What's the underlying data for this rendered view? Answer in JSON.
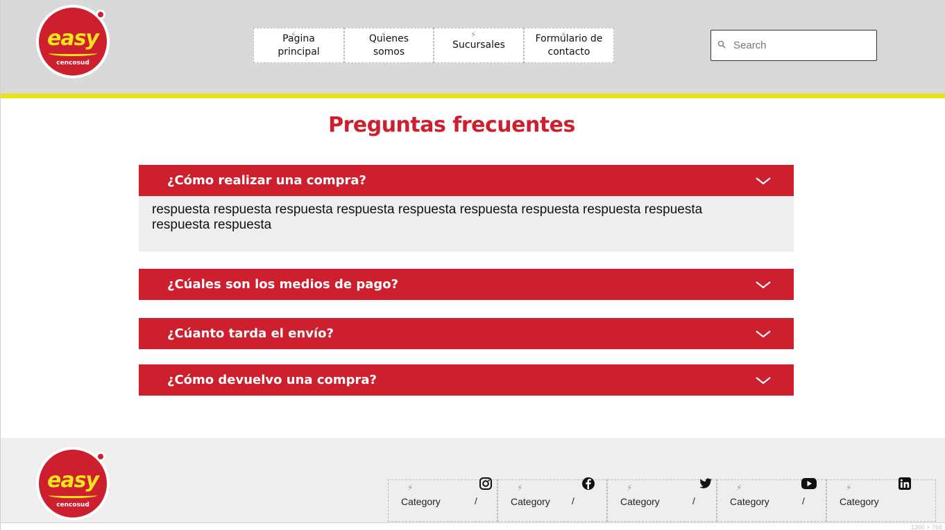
{
  "header": {
    "logo": {
      "brand": "easy",
      "sub": "cencosud"
    },
    "nav": [
      {
        "label": "Pagina principal",
        "lines": [
          "Pagina",
          "principal"
        ]
      },
      {
        "label": "Quienes somos",
        "lines": [
          "Quienes",
          "somos"
        ]
      },
      {
        "label": "Sucursales",
        "lines": [
          "Sucursales"
        ]
      },
      {
        "label": "Formulario de contacto",
        "lines": [
          "Formulario de",
          "contacto"
        ]
      }
    ],
    "search": {
      "placeholder": "Search",
      "value": ""
    }
  },
  "main": {
    "title": "Preguntas frecuentes",
    "faqs": [
      {
        "question": "¿Cómo realizar una compra?",
        "expanded": true,
        "answer": "respuesta respuesta respuesta respuesta respuesta respuesta respuesta respuesta respuesta respuesta respuesta"
      },
      {
        "question": "¿Cúales son los medios de pago?",
        "expanded": false
      },
      {
        "question": "¿Cúanto tarda el envío?",
        "expanded": false
      },
      {
        "question": "¿Cómo devuelvo una compra?",
        "expanded": false
      }
    ]
  },
  "footer": {
    "logo": {
      "brand": "easy",
      "sub": "cencosud"
    },
    "categories": [
      {
        "label": "Category",
        "separator": "/",
        "icon": "instagram-icon"
      },
      {
        "label": "Category",
        "separator": "/",
        "icon": "facebook-icon"
      },
      {
        "label": "Category",
        "separator": "/",
        "icon": "twitter-icon"
      },
      {
        "label": "Category",
        "separator": "/",
        "icon": "youtube-icon"
      },
      {
        "label": "Category",
        "separator": "",
        "icon": "linkedin-icon"
      }
    ],
    "resize_label": "1366 × 768"
  },
  "colors": {
    "brand_red": "#cd1f2d",
    "brand_yellow": "#e8e21c",
    "header_bg": "#d9d9d9",
    "footer_bg": "#eeeeee"
  }
}
